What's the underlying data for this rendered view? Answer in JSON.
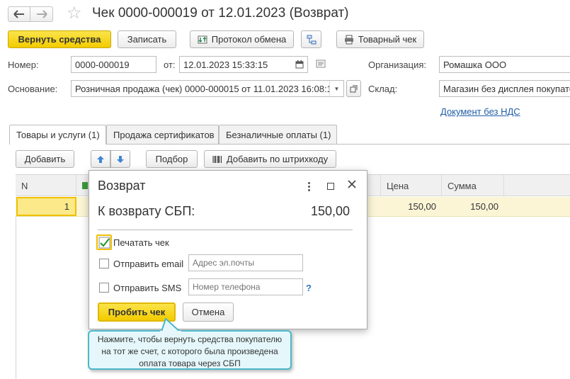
{
  "header": {
    "title": "Чек 0000-000019 от 12.01.2023 (Возврат)"
  },
  "toolbar": {
    "return_funds": "Вернуть средства",
    "save": "Записать",
    "exchange_protocol": "Протокол обмена",
    "goods_receipt": "Товарный чек"
  },
  "form": {
    "number_label": "Номер:",
    "number_value": "0000-000019",
    "date_label": "от:",
    "date_value": "12.01.2023 15:33:15",
    "organization_label": "Организация:",
    "organization_value": "Ромашка ООО",
    "basis_label": "Основание:",
    "basis_value": "Розничная продажа (чек) 0000-000015 от 11.01.2023 16:08:1",
    "warehouse_label": "Склад:",
    "warehouse_value": "Магазин без дисплея покупателя",
    "vat_link": "Документ без НДС"
  },
  "tabs": [
    {
      "label": "Товары и услуги (1)"
    },
    {
      "label": "Продажа сертификатов"
    },
    {
      "label": "Безналичные оплаты (1)"
    }
  ],
  "table_toolbar": {
    "add": "Добавить",
    "pick": "Подбор",
    "add_barcode": "Добавить по штрихкоду"
  },
  "table": {
    "columns": {
      "n": "N",
      "price": "Цена",
      "sum": "Сумма"
    },
    "rows": [
      {
        "n": "1",
        "price": "150,00",
        "sum": "150,00"
      }
    ]
  },
  "dialog": {
    "title": "Возврат",
    "amount_label": "К возврату СБП:",
    "amount_value": "150,00",
    "print_check": "Печатать чек",
    "print_checked": true,
    "send_email": "Отправить email",
    "email_placeholder": "Адрес эл.почты",
    "send_sms": "Отправить SMS",
    "phone_placeholder": "Номер телефона",
    "help": "?",
    "punch_button": "Пробить чек",
    "cancel_button": "Отмена"
  },
  "tooltip": {
    "text": "Нажмите, чтобы вернуть средства покупателю на тот же счет, с которого была произведена оплата товара через СБП"
  },
  "colors": {
    "accent_yellow": "#f5d000",
    "link_blue": "#1f5ea8",
    "tooltip_border": "#4bb7c8",
    "arrow_blue": "#3f86d6"
  }
}
